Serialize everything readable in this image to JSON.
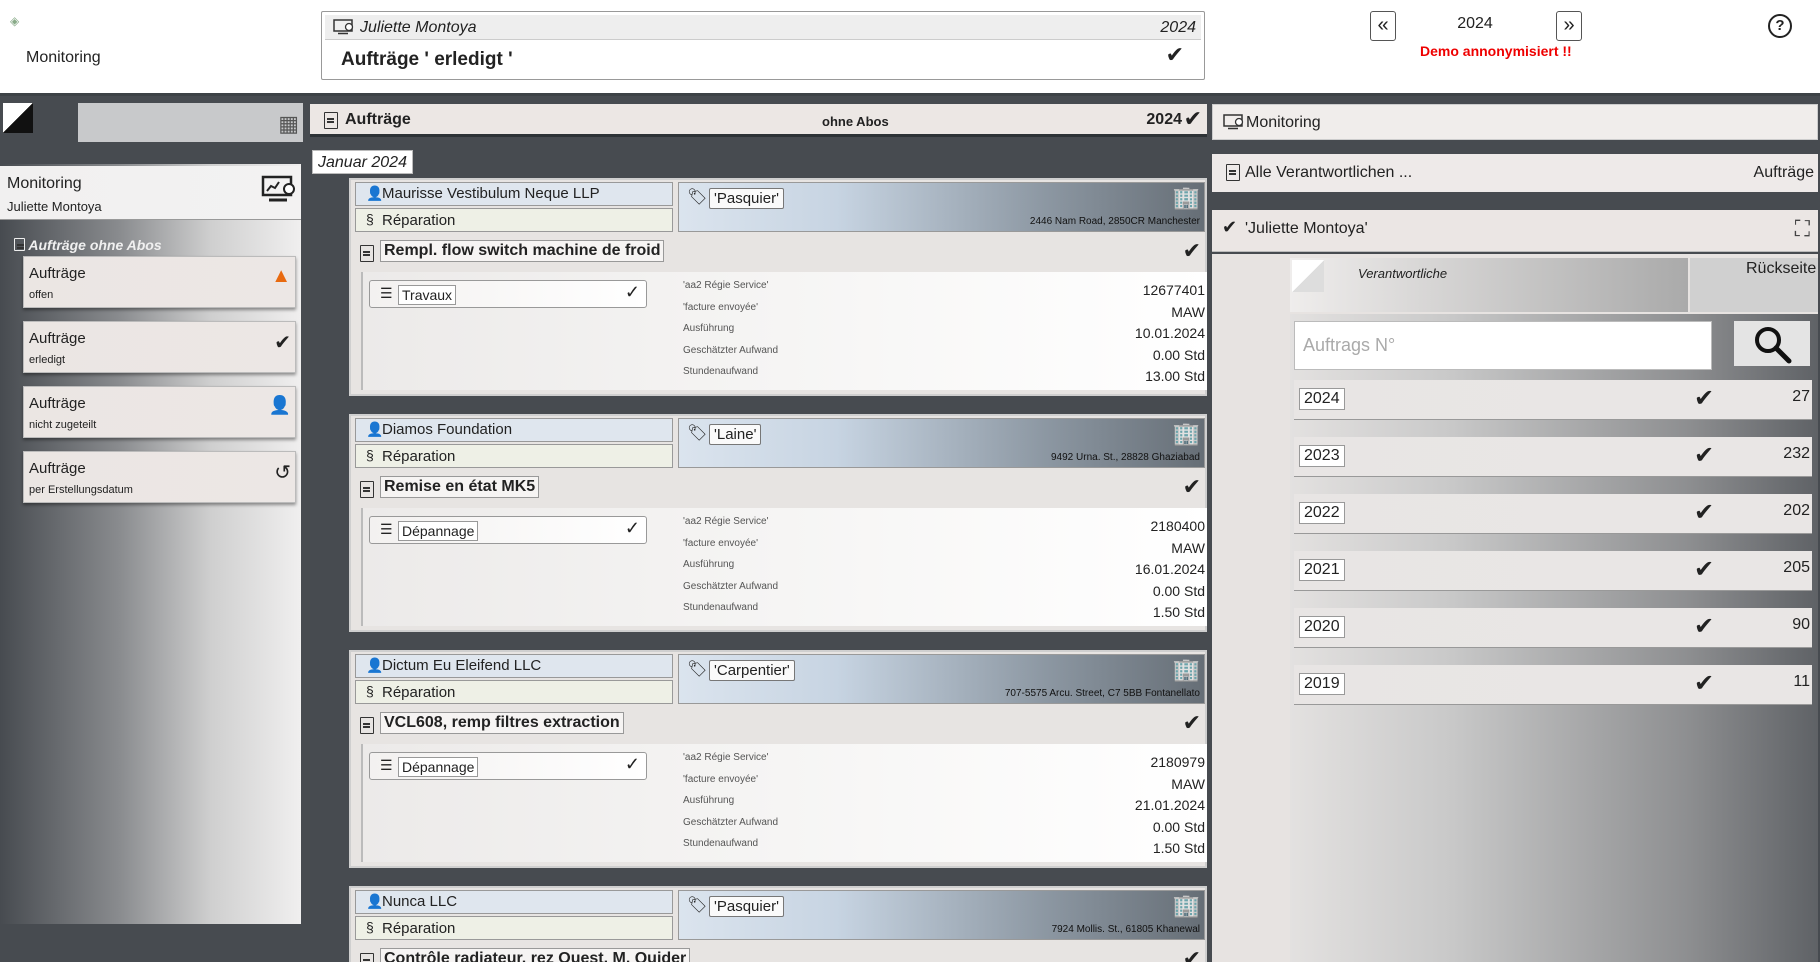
{
  "header": {
    "app_name": "Monitoring",
    "user": "Juliette Montoya",
    "year": "2024",
    "heading": "Aufträge ' erledigt '",
    "nav_year": "2024",
    "demo_notice": "Demo annonymisiert !!"
  },
  "left": {
    "monitor_title": "Monitoring",
    "monitor_user": "Juliette Montoya",
    "group_label": "Aufträge ohne Abos",
    "items": [
      {
        "title": "Aufträge",
        "sub": "offen",
        "icon": "cone-icon"
      },
      {
        "title": "Aufträge",
        "sub": "erledigt",
        "icon": "check-icon"
      },
      {
        "title": "Aufträge",
        "sub": "nicht zugeteilt",
        "icon": "person-minus-icon"
      },
      {
        "title": "Aufträge",
        "sub": "per Erstellungsdatum",
        "icon": "history-icon"
      }
    ]
  },
  "center": {
    "title": "Aufträge",
    "mode": "ohne Abos",
    "year": "2024",
    "month": "Januar 2024",
    "orders": [
      {
        "customer": "Maurisse Vestibulum Neque LLP",
        "type": "Réparation",
        "tag": "'Pasquier'",
        "address": "2446 Nam Road, 2850CR Manchester",
        "title": "Rempl. flow switch machine de froid",
        "category": "Travaux",
        "fields": [
          {
            "k": "'aa2 Régie Service'",
            "v": "12677401"
          },
          {
            "k": "'facture envoyée'",
            "v": "MAW"
          },
          {
            "k": "Ausführung",
            "v": "10.01.2024"
          },
          {
            "k": "Geschätzter Aufwand",
            "v": "0.00 Std"
          },
          {
            "k": "Stundenaufwand",
            "v": "13.00 Std"
          }
        ]
      },
      {
        "customer": "Diamos Foundation",
        "type": "Réparation",
        "tag": "'Laine'",
        "address": "9492 Urna. St., 28828 Ghaziabad",
        "title": "Remise en état MK5",
        "category": "Dépannage",
        "fields": [
          {
            "k": "'aa2 Régie Service'",
            "v": "2180400"
          },
          {
            "k": "'facture envoyée'",
            "v": "MAW"
          },
          {
            "k": "Ausführung",
            "v": "16.01.2024"
          },
          {
            "k": "Geschätzter Aufwand",
            "v": "0.00 Std"
          },
          {
            "k": "Stundenaufwand",
            "v": "1.50 Std"
          }
        ]
      },
      {
        "customer": "Dictum Eu Eleifend LLC",
        "type": "Réparation",
        "tag": "'Carpentier'",
        "address": "707-5575 Arcu. Street, C7 5BB Fontanellato",
        "title": "VCL608, remp filtres extraction",
        "category": "Dépannage",
        "fields": [
          {
            "k": "'aa2 Régie Service'",
            "v": "2180979"
          },
          {
            "k": "'facture envoyée'",
            "v": "MAW"
          },
          {
            "k": "Ausführung",
            "v": "21.01.2024"
          },
          {
            "k": "Geschätzter Aufwand",
            "v": "0.00 Std"
          },
          {
            "k": "Stundenaufwand",
            "v": "1.50 Std"
          }
        ]
      },
      {
        "customer": "Nunca LLC",
        "type": "Réparation",
        "tag": "'Pasquier'",
        "address": "7924 Mollis. St., 61805 Khanewal",
        "title": "Contrôle radiateur, rez Ouest, M. Quider"
      }
    ]
  },
  "right": {
    "monitor_title": "Monitoring",
    "all_label": "Alle Verantwortlichen ...",
    "all_right": "Aufträge",
    "person": "'Juliette Montoya'",
    "tab_label": "Verantwortliche",
    "back_label": "Rückseite",
    "search_placeholder": "Auftrags N°",
    "years": [
      {
        "year": "2024",
        "count": "27"
      },
      {
        "year": "2023",
        "count": "232"
      },
      {
        "year": "2022",
        "count": "202"
      },
      {
        "year": "2021",
        "count": "205"
      },
      {
        "year": "2020",
        "count": "90"
      },
      {
        "year": "2019",
        "count": "11"
      }
    ]
  }
}
